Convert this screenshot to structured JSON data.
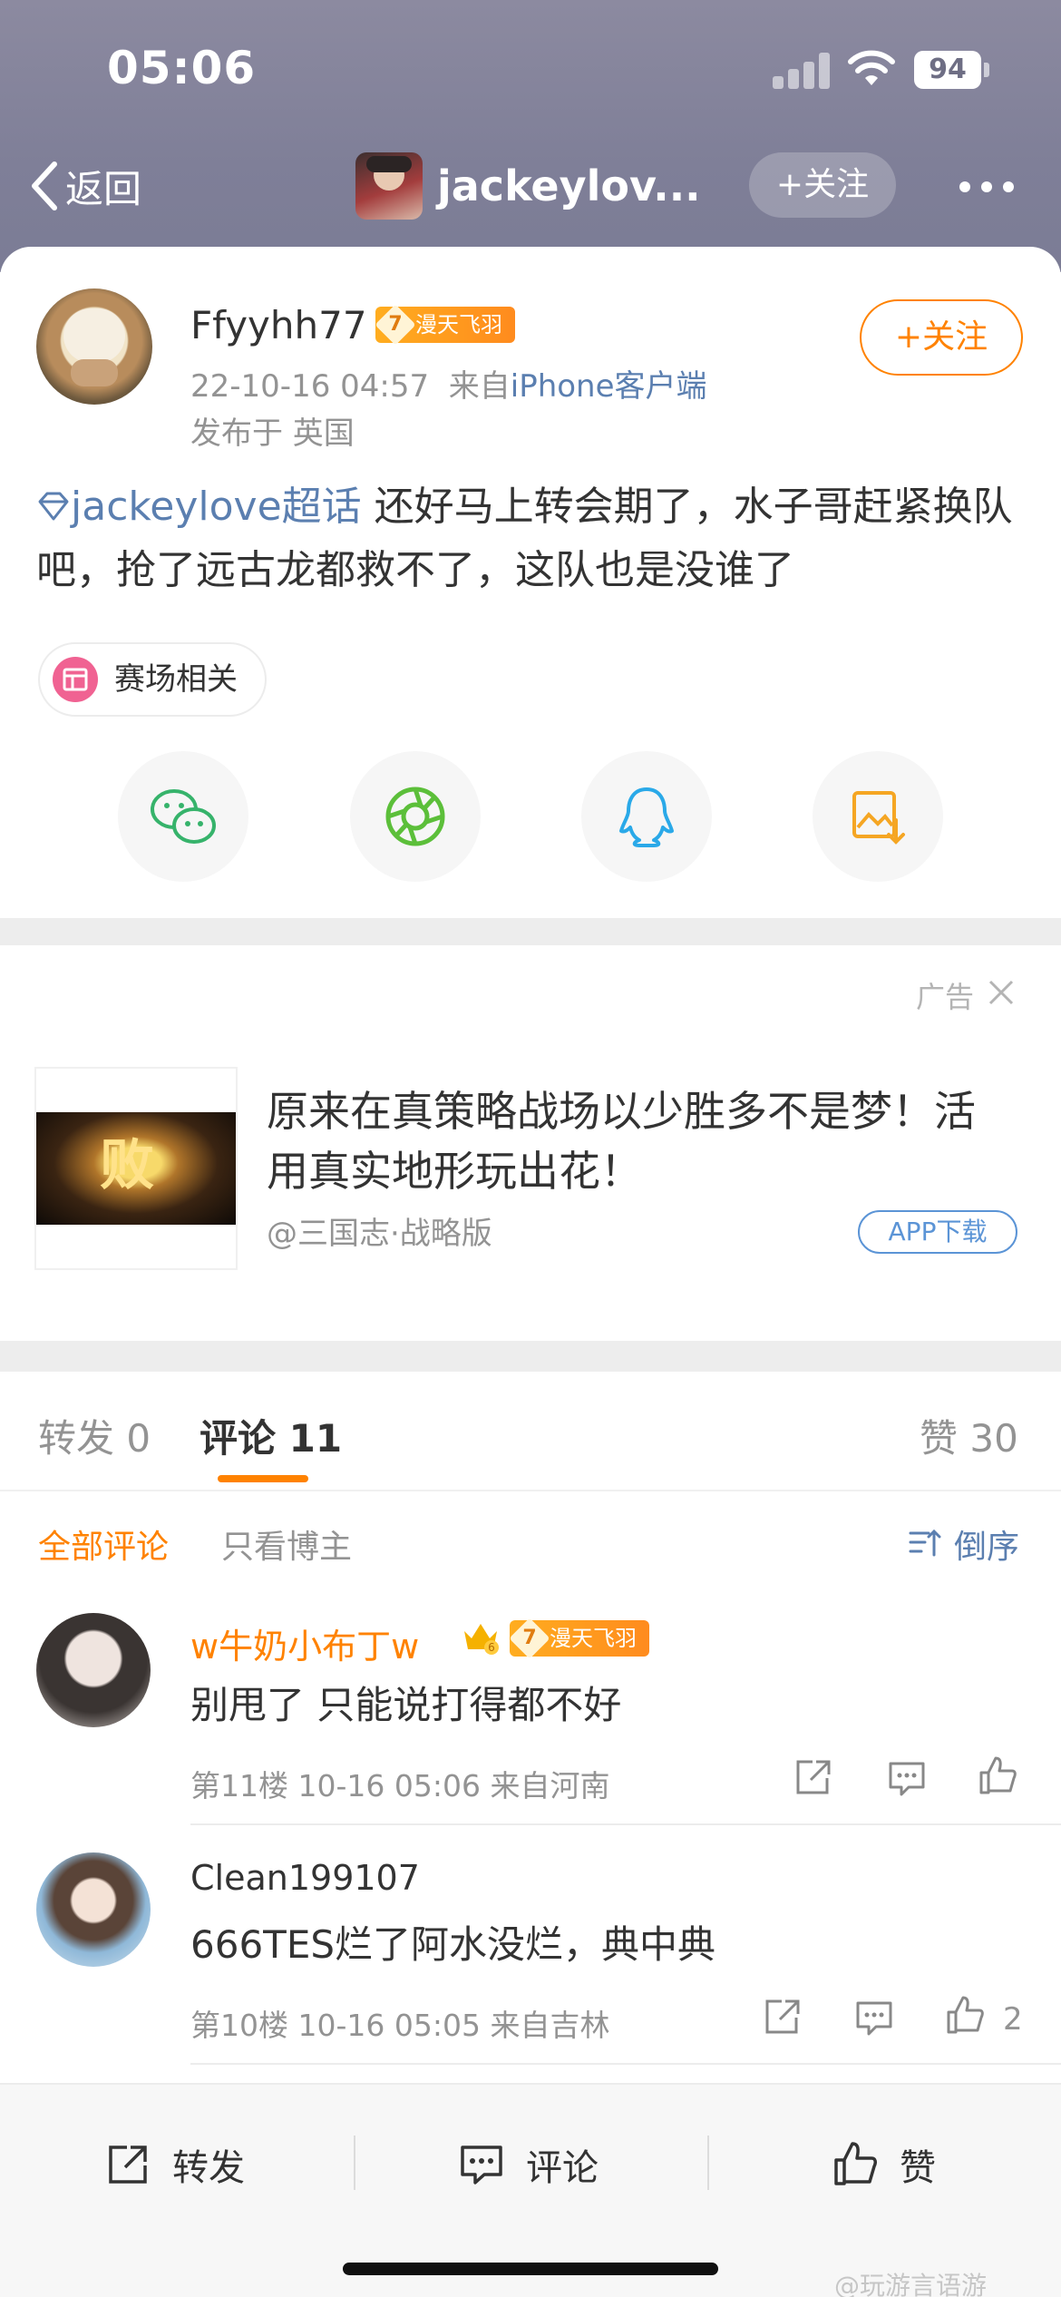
{
  "status_bar": {
    "time": "05:06",
    "battery": "94"
  },
  "nav": {
    "back_label": "返回",
    "title": "jackeylov...",
    "follow_label": "+关注"
  },
  "post": {
    "author": "Ffyyhh77",
    "badge_level": "7",
    "badge_text": "漫天飞羽",
    "time": "22-10-16 04:57",
    "from_prefix": "来自",
    "source": "iPhone客户端",
    "location": "发布于 英国",
    "follow_label": "+关注",
    "topic": "jackeylove超话",
    "text": "还好马上转会期了，水子哥赶紧换队吧，抢了远古龙都救不了，这队也是没谁了",
    "tag": "赛场相关"
  },
  "share_icons": [
    "wechat-icon",
    "moments-icon",
    "qq-icon",
    "save-image-icon"
  ],
  "ad": {
    "label": "广告",
    "title": "原来在真策略战场以少胜多不是梦！活用真实地形玩出花！",
    "source": "@三国志·战略版",
    "button": "APP下载",
    "image_glyph": "败"
  },
  "tabs": {
    "repost": "转发 0",
    "comment": "评论 11",
    "like": "赞 30"
  },
  "filters": {
    "all": "全部评论",
    "author_only": "只看博主",
    "sort": "倒序"
  },
  "comments": [
    {
      "name": "w牛奶小布丁w",
      "crown_level": "6",
      "badge_level": "7",
      "badge_text": "漫天飞羽",
      "text": "别甩了 只能说打得都不好",
      "meta": "第11楼 10-16 05:06 来自河南",
      "likes": ""
    },
    {
      "name": "Clean199107",
      "text": "666TES烂了阿水没烂，典中典",
      "meta": "第10楼 10-16 05:05 来自吉林",
      "likes": "2"
    }
  ],
  "bottom_bar": {
    "repost": "转发",
    "comment": "评论",
    "like": "赞"
  },
  "watermark": "@玩游言语游",
  "colors": {
    "accent": "#ff8200",
    "link": "#5b7fb0",
    "muted": "#939393"
  }
}
